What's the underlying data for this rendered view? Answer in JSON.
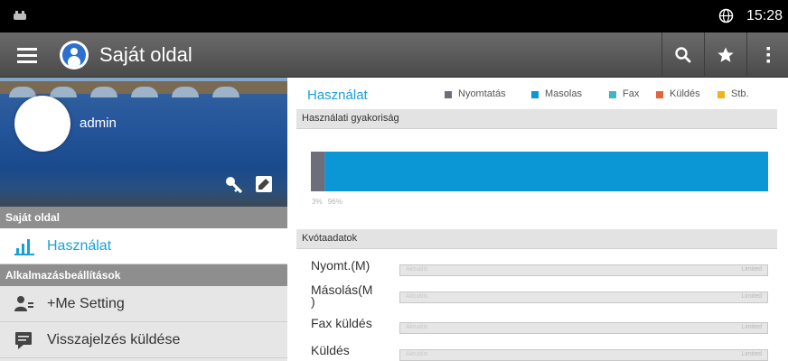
{
  "status_bar": {
    "time": "15:28"
  },
  "action_bar": {
    "title": "Saját oldal",
    "search_icon": "search-icon",
    "star_icon": "star-icon",
    "overflow_icon": "overflow-menu-icon"
  },
  "drawer": {
    "username": "admin",
    "section_my_page": "Saját oldal",
    "usage_item": "Használat",
    "section_app_settings": "Alkalmazásbeállítások",
    "me_setting_item": "+Me Setting",
    "feedback_item": "Visszajelzés küldése"
  },
  "main": {
    "usage_title": "Használat",
    "legend": [
      {
        "label": "Nyomtatás",
        "color": "#6e6e7a"
      },
      {
        "label": "Masolas",
        "color": "#0b96d6"
      },
      {
        "label": "Fax",
        "color": "#3bb8c4"
      },
      {
        "label": "Küldés",
        "color": "#e5643a"
      },
      {
        "label": "Stb.",
        "color": "#f0b31e"
      }
    ],
    "frequency_header": "Használati gyakoriság",
    "pct_print": "3%",
    "pct_copy": "96%",
    "quota_header": "Kvótaadatok",
    "quotas": [
      {
        "label": "Nyomt.(M)",
        "current": "Aktuális",
        "limit": "Limited"
      },
      {
        "label": "Másolás(M\n)",
        "current": "Aktuális",
        "limit": "Limited"
      },
      {
        "label": "Fax küldés",
        "current": "Aktuális",
        "limit": "Limited"
      },
      {
        "label": "Küldés",
        "current": "Aktuális",
        "limit": "Limited"
      }
    ]
  },
  "chart_data": {
    "type": "bar",
    "categories": [
      "Nyomtatás",
      "Masolas"
    ],
    "values": [
      3,
      96
    ],
    "colors": [
      "#6e6e7a",
      "#0b96d6"
    ],
    "title": "Használati gyakoriság",
    "unit": "%"
  }
}
